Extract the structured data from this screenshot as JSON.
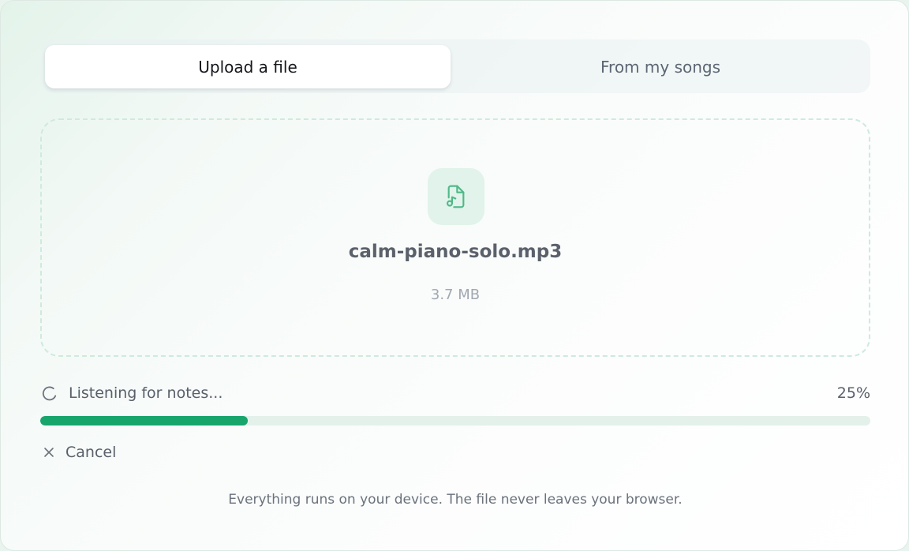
{
  "tabs": [
    {
      "label": "Upload a file",
      "active": true
    },
    {
      "label": "From my songs",
      "active": false
    }
  ],
  "file": {
    "name": "calm-piano-solo.mp3",
    "size": "3.7 MB",
    "icon": "file-music-icon"
  },
  "status": {
    "text": "Listening for notes...",
    "percent_label": "25%",
    "progress": 0.25
  },
  "cancel": {
    "label": "Cancel"
  },
  "footer": {
    "note": "Everything runs on your device. The file never leaves your browser."
  },
  "colors": {
    "accent": "#17a56c",
    "track": "#e3f1ea",
    "icon_bg": "#e1f3ea",
    "icon_stroke": "#4fb888"
  }
}
